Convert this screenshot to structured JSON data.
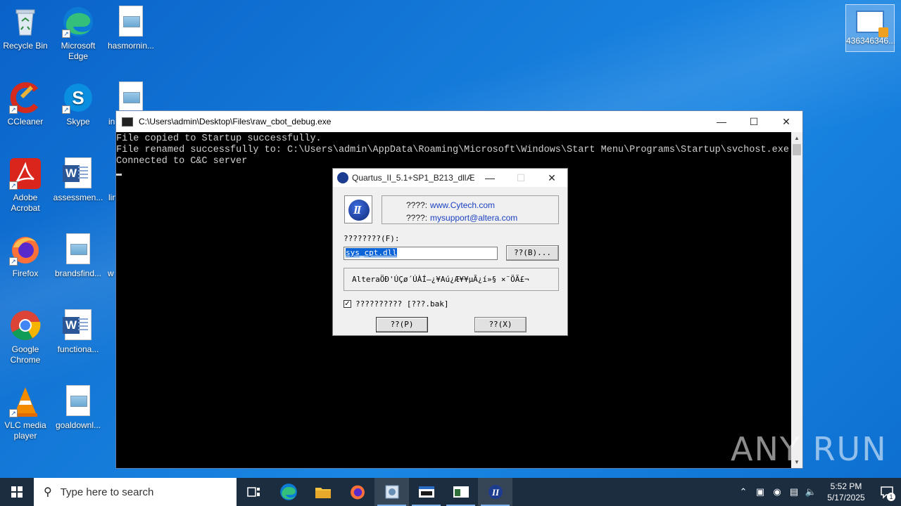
{
  "desktop": {
    "icons": [
      {
        "label": "Recycle Bin"
      },
      {
        "label": "Microsoft Edge"
      },
      {
        "label": "hasmornin..."
      },
      {
        "label": "CCleaner"
      },
      {
        "label": "Skype"
      },
      {
        "label": "in"
      },
      {
        "label": "Adobe Acrobat"
      },
      {
        "label": "assessmen..."
      },
      {
        "label": "lin"
      },
      {
        "label": "Firefox"
      },
      {
        "label": "brandsfind..."
      },
      {
        "label": "w"
      },
      {
        "label": "Google Chrome"
      },
      {
        "label": "functiona..."
      },
      {
        "label": "VLC media player"
      },
      {
        "label": "goaldownl..."
      }
    ],
    "top_right_icon": {
      "label": "436346346..."
    }
  },
  "console": {
    "title": "C:\\Users\\admin\\Desktop\\Files\\raw_cbot_debug.exe",
    "lines": [
      "File copied to Startup successfully.",
      "File renamed successfully to: C:\\Users\\admin\\AppData\\Roaming\\Microsoft\\Windows\\Start Menu\\Programs\\Startup\\svchost.exe",
      "Connected to C&C server"
    ]
  },
  "dialog": {
    "title": "Quartus_II_5.1+SP1_B213_dllÆ...",
    "info": {
      "row1_label": "????:",
      "row1_link": "www.Cytech.com",
      "row2_label": "????:",
      "row2_link": "mysupport@altera.com"
    },
    "file_label": "????????(F):",
    "file_value": "sys_cpt.dll",
    "browse_button": "??(B)...",
    "message": "AlteraÖÐ'ÚÇø´ÚÀÍ—¿¥Aú¿Æ¥¥µÃ¿í»§ ×¨ÖÃ£¬",
    "backup_checkbox": {
      "label": "?????????? [???.bak]",
      "checked": true
    },
    "ok_button": "??(P)",
    "exit_button": "??(X)"
  },
  "watermark": "ANY RUN",
  "taskbar": {
    "search_placeholder": "Type here to search",
    "time": "5:52 PM",
    "date": "5/17/2025",
    "notification_count": "1"
  }
}
